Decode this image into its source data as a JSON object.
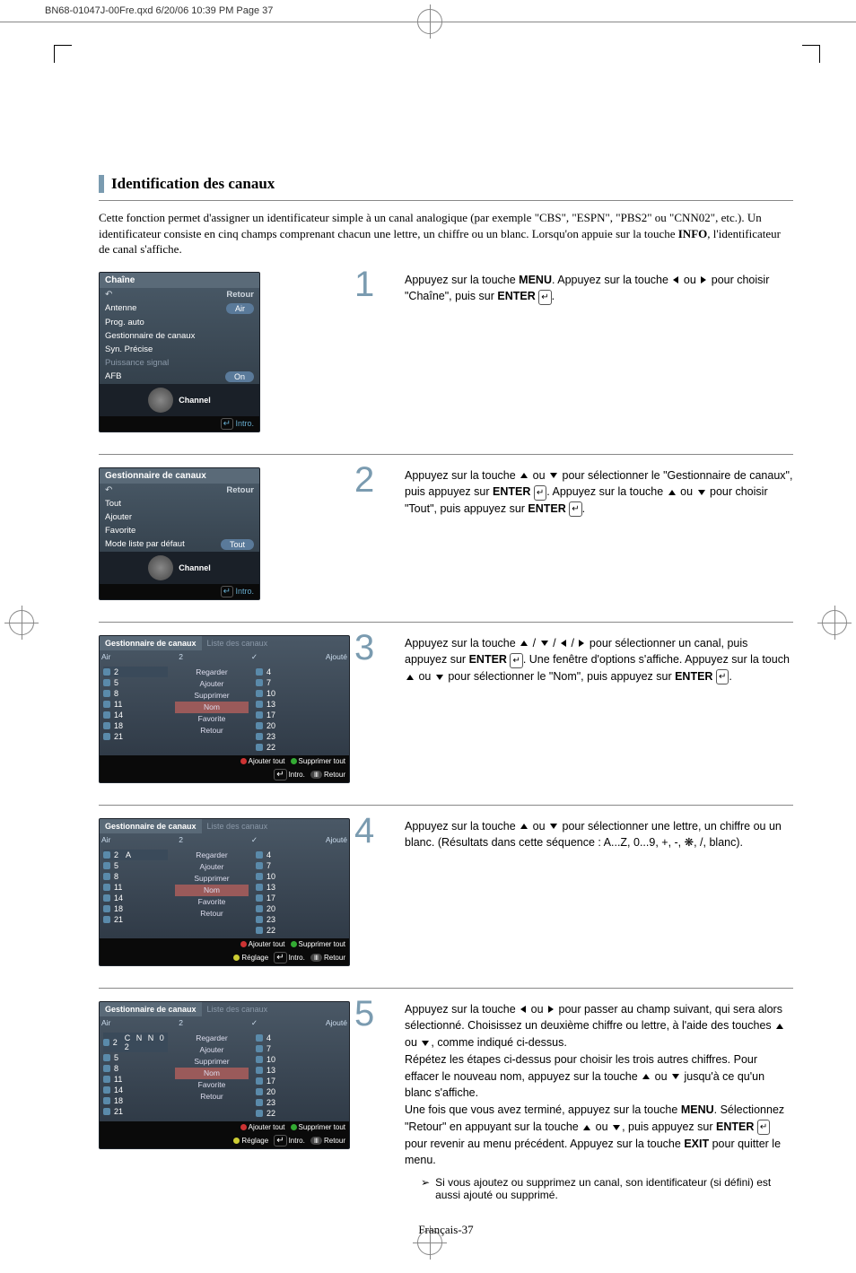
{
  "header": "BN68-01047J-00Fre.qxd  6/20/06  10:39 PM  Page 37",
  "title": "Identification des canaux",
  "intro_1": "Cette fonction permet d'assigner un identificateur simple à un canal analogique (par exemple \"CBS\", \"ESPN\", \"PBS2\" ou \"CNN02\", etc.). Un identificateur consiste en cinq champs comprenant chacun une lettre, un chiffre ou un blanc. Lorsqu'on appuie sur la touche ",
  "intro_bold": "INFO",
  "intro_2": ", l'identificateur de canal s'affiche.",
  "tv1": {
    "title": "Chaîne",
    "return": "Retour",
    "rows": [
      {
        "l": "Antenne",
        "r": "Air"
      },
      {
        "l": "Prog. auto",
        "r": ""
      },
      {
        "l": "Gestionnaire de canaux",
        "r": ""
      },
      {
        "l": "Syn. Précise",
        "r": ""
      },
      {
        "l": "Puissance signal",
        "r": "",
        "dim": true
      },
      {
        "l": "AFB",
        "r": "On"
      }
    ],
    "bottom": "Channel",
    "footer": "Intro."
  },
  "tv2": {
    "title": "Gestionnaire de canaux",
    "return": "Retour",
    "rows": [
      {
        "l": "Tout"
      },
      {
        "l": "Ajouter"
      },
      {
        "l": "Favorite"
      },
      {
        "l": "Mode liste par défaut",
        "r": "Tout"
      }
    ],
    "bottom": "Channel",
    "footer": "Intro."
  },
  "list_common": {
    "tab_active": "Gestionnaire de canaux",
    "tab_inactive": "Liste des canaux",
    "hdr_air": "Air",
    "hdr_num": "2",
    "hdr_add": "Ajouté",
    "opts": [
      "Regarder",
      "Ajouter",
      "Supprimer",
      "Nom",
      "Favorite",
      "Retour"
    ],
    "left_ch": [
      "2",
      "5",
      "8",
      "11",
      "14",
      "18",
      "21"
    ],
    "right_ch": [
      "4",
      "7",
      "10",
      "13",
      "17",
      "20",
      "23",
      "22"
    ],
    "ftr_add_all": "Ajouter tout",
    "ftr_del_all": "Supprimer tout",
    "ftr_reglage": "Réglage",
    "ftr_intro": "Intro.",
    "ftr_retour": "Retour"
  },
  "tv3_name": "",
  "tv4_name": "A",
  "tv5_name": "C N N 0 2",
  "step1_a": "Appuyez sur la touche ",
  "step1_menu": "MENU",
  "step1_b": ". Appuyez sur la touche ",
  "step1_c": " ou ",
  "step1_d": " pour choisir \"Chaîne\", puis sur ",
  "step1_enter": "ENTER",
  "step1_e": ".",
  "step2_a": "Appuyez sur la touche ",
  "step2_b": " ou ",
  "step2_c": " pour sélectionner le \"Gestionnaire de canaux\", puis appuyez sur ",
  "step2_d": ". Appuyez sur la touche ",
  "step2_e": " pour choisir \"Tout\", puis appuyez sur ",
  "step3_a": "Appuyez sur la touche ",
  "step3_b": " pour sélectionner un canal, puis appuyez sur ",
  "step3_c": ". Une fenêtre d'options s'affiche. Appuyez sur la touch ",
  "step3_d": " pour sélectionner le \"Nom\", puis appuyez sur ",
  "step4_a": "Appuyez sur la touche ",
  "step4_b": " ou ",
  "step4_c": " pour sélectionner une lettre, un chiffre ou un blanc. (Résultats dans cette séquence : A...Z, 0...9, +, -, ❋, /, blanc).",
  "step5_a": "Appuyez sur la touche ",
  "step5_b": " ou ",
  "step5_c": " pour passer au champ suivant, qui sera alors sélectionné. Choisissez un deuxième chiffre ou lettre, à l'aide des touches ",
  "step5_d": ", comme indiqué ci-dessus.",
  "step5_e": "Répétez les étapes ci-dessus pour choisir les trois autres chiffres. Pour effacer le nouveau nom, appuyez sur la touche ",
  "step5_f": " jusqu'à ce qu'un blanc s'affiche.",
  "step5_g": "Une fois que vous avez terminé, appuyez sur la touche ",
  "step5_h": ". Sélectionnez \"Retour\" en appuyant sur la touche ",
  "step5_i": ", puis appuyez sur ",
  "step5_j": " pour revenir au menu précédent. Appuyez sur la touche ",
  "step5_exit": "EXIT",
  "step5_k": " pour quitter le menu.",
  "note": "Si vous ajoutez ou supprimez un canal, son identificateur (si défini) est aussi ajouté ou supprimé.",
  "pagenum": "Français-37",
  "nums": {
    "1": "1",
    "2": "2",
    "3": "3",
    "4": "4",
    "5": "5"
  }
}
